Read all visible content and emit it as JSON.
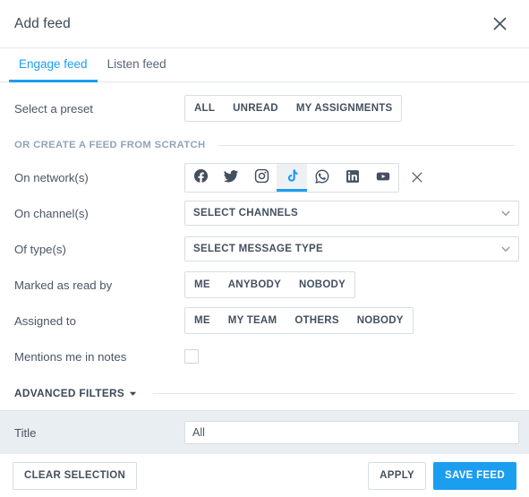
{
  "header": {
    "title": "Add feed",
    "close_icon": "close-icon"
  },
  "tabs": [
    {
      "label": "Engage feed",
      "active": true
    },
    {
      "label": "Listen feed",
      "active": false
    }
  ],
  "colors": {
    "accent": "#1b9df0",
    "text": "#3c4858",
    "muted": "#93a4b5",
    "border": "#d7dde4",
    "band": "#e9eef2"
  },
  "preset_row": {
    "label": "Select a preset",
    "options": [
      "ALL",
      "UNREAD",
      "MY ASSIGNMENTS"
    ]
  },
  "scratch_divider": {
    "label": "OR CREATE A FEED FROM SCRATCH"
  },
  "networks_row": {
    "label": "On network(s)",
    "items": [
      {
        "name": "facebook",
        "icon": "facebook-icon",
        "selected": false
      },
      {
        "name": "twitter",
        "icon": "twitter-icon",
        "selected": false
      },
      {
        "name": "instagram",
        "icon": "instagram-icon",
        "selected": false
      },
      {
        "name": "tiktok",
        "icon": "tiktok-icon",
        "selected": true
      },
      {
        "name": "whatsapp",
        "icon": "whatsapp-icon",
        "selected": false
      },
      {
        "name": "linkedin",
        "icon": "linkedin-icon",
        "selected": false
      },
      {
        "name": "youtube",
        "icon": "youtube-icon",
        "selected": false
      }
    ],
    "clear_icon": "close-icon"
  },
  "channels_row": {
    "label": "On channel(s)",
    "value": "SELECT CHANNELS",
    "caret_icon": "chevron-down-icon"
  },
  "types_row": {
    "label": "Of type(s)",
    "value": "SELECT MESSAGE TYPE",
    "caret_icon": "chevron-down-icon"
  },
  "read_by_row": {
    "label": "Marked as read by",
    "options": [
      "ME",
      "ANYBODY",
      "NOBODY"
    ]
  },
  "assigned_row": {
    "label": "Assigned to",
    "options": [
      "ME",
      "MY TEAM",
      "OTHERS",
      "NOBODY"
    ]
  },
  "mentions_row": {
    "label": "Mentions me in notes",
    "checked": false
  },
  "advanced_filters": {
    "label": "ADVANCED FILTERS",
    "caret_icon": "caret-down-icon",
    "expanded": true
  },
  "title_row": {
    "label": "Title",
    "value": "All",
    "placeholder": "All"
  },
  "footer": {
    "clear_label": "CLEAR SELECTION",
    "apply_label": "APPLY",
    "save_label": "SAVE FEED"
  }
}
